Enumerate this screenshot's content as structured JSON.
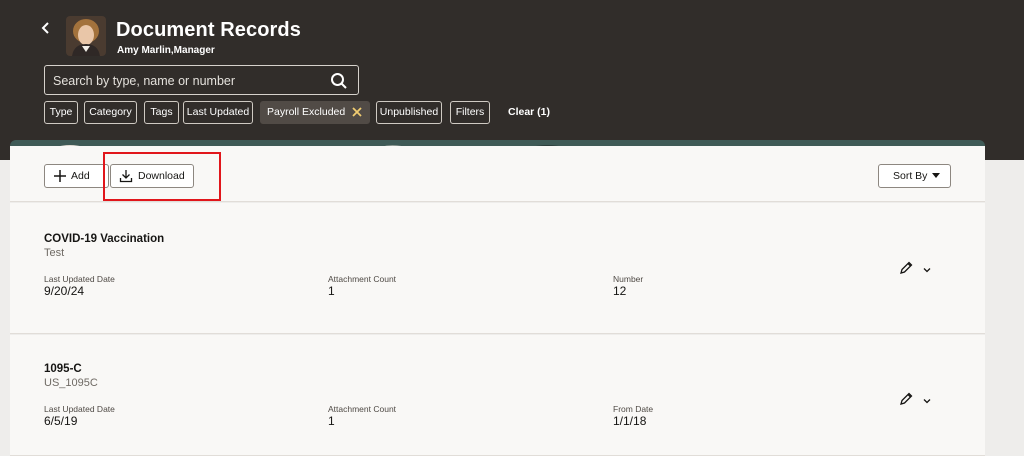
{
  "header": {
    "title": "Document Records",
    "person": "Amy Marlin,Manager"
  },
  "search": {
    "placeholder": "Search by type, name or number"
  },
  "filters": [
    {
      "label": "Type"
    },
    {
      "label": "Category"
    },
    {
      "label": "Tags"
    },
    {
      "label": "Last Updated"
    },
    {
      "label": "Payroll Excluded",
      "active": true
    },
    {
      "label": "Unpublished"
    },
    {
      "label": "Filters"
    }
  ],
  "clear_label": "Clear (1)",
  "toolbar": {
    "add_label": "Add",
    "download_label": "Download",
    "sort_label": "Sort By"
  },
  "records": [
    {
      "title": "COVID-19 Vaccination",
      "subtitle": "Test",
      "fields": [
        {
          "label": "Last Updated Date",
          "value": "9/20/24"
        },
        {
          "label": "Attachment Count",
          "value": "1"
        },
        {
          "label": "Number",
          "value": "12"
        }
      ]
    },
    {
      "title": "1095-C",
      "subtitle": "US_1095C",
      "fields": [
        {
          "label": "Last Updated Date",
          "value": "6/5/19"
        },
        {
          "label": "Attachment Count",
          "value": "1"
        },
        {
          "label": "From Date",
          "value": "1/1/18"
        }
      ]
    }
  ],
  "colors": {
    "header_bg": "#312d2a",
    "highlight": "#e1161b",
    "accent_yellow": "#f0cc71"
  },
  "icons": [
    "back-icon",
    "search-icon",
    "close-icon",
    "add-icon",
    "download-icon",
    "caret-down-icon",
    "edit-icon",
    "chevron-down-icon"
  ]
}
